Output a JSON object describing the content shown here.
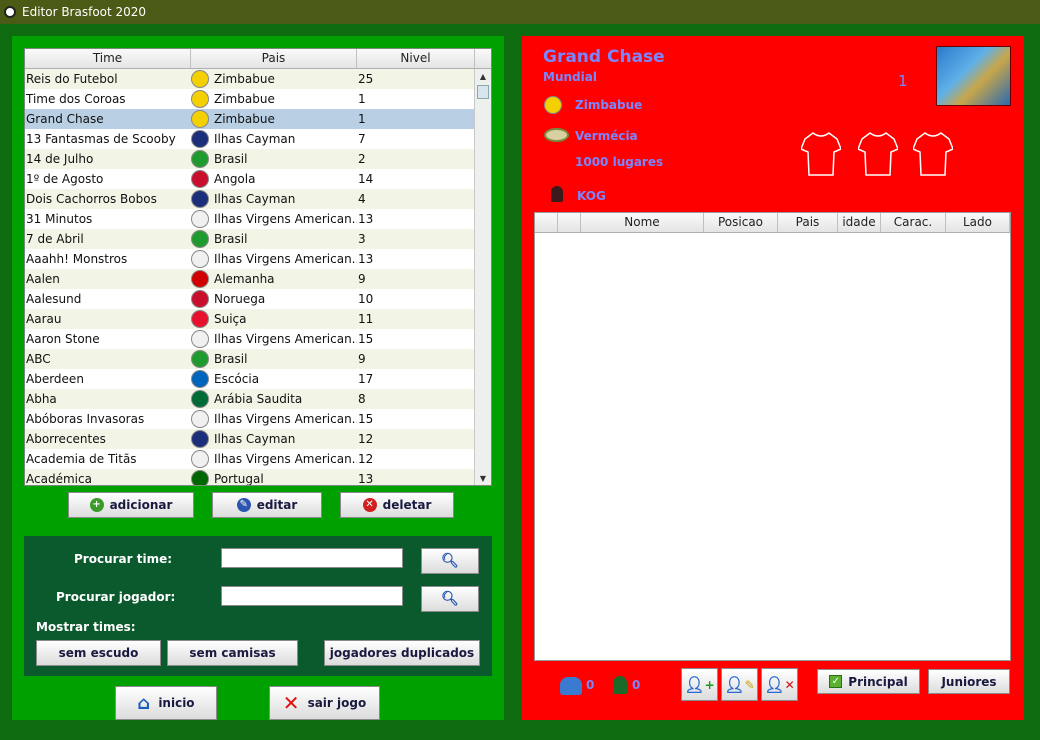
{
  "window": {
    "title": "Editor Brasfoot 2020"
  },
  "teams_table": {
    "headers": {
      "time": "Time",
      "pais": "Pais",
      "nivel": "Nivel"
    },
    "rows": [
      {
        "time": "Reis do Futebol",
        "pais": "Zimbabue",
        "nivel": "25",
        "flag": "zimbabwe-flag-icon",
        "color": "#f4d000"
      },
      {
        "time": "Time dos Coroas",
        "pais": "Zimbabue",
        "nivel": "1",
        "flag": "zimbabwe-flag-icon",
        "color": "#f4d000"
      },
      {
        "time": "Grand Chase",
        "pais": "Zimbabue",
        "nivel": "1",
        "flag": "zimbabwe-flag-icon",
        "color": "#f4d000"
      },
      {
        "time": "13 Fantasmas de Scooby",
        "pais": "Ilhas Cayman",
        "nivel": "7",
        "flag": "cayman-flag-icon",
        "color": "#1c2f7a"
      },
      {
        "time": "14 de Julho",
        "pais": "Brasil",
        "nivel": "2",
        "flag": "brazil-flag-icon",
        "color": "#1f9a2c"
      },
      {
        "time": "1º de Agosto",
        "pais": "Angola",
        "nivel": "14",
        "flag": "angola-flag-icon",
        "color": "#c8102e"
      },
      {
        "time": "Dois Cachorros Bobos",
        "pais": "Ilhas Cayman",
        "nivel": "4",
        "flag": "cayman-flag-icon",
        "color": "#1c2f7a"
      },
      {
        "time": "31 Minutos",
        "pais": "Ilhas Virgens American...",
        "nivel": "13",
        "flag": "usvi-flag-icon",
        "color": "#f0f0f0"
      },
      {
        "time": "7 de Abril",
        "pais": "Brasil",
        "nivel": "3",
        "flag": "brazil-flag-icon",
        "color": "#1f9a2c"
      },
      {
        "time": "Aaahh! Monstros",
        "pais": "Ilhas Virgens American...",
        "nivel": "13",
        "flag": "usvi-flag-icon",
        "color": "#f0f0f0"
      },
      {
        "time": "Aalen",
        "pais": "Alemanha",
        "nivel": "9",
        "flag": "germany-flag-icon",
        "color": "#d00000"
      },
      {
        "time": "Aalesund",
        "pais": "Noruega",
        "nivel": "10",
        "flag": "norway-flag-icon",
        "color": "#c8102e"
      },
      {
        "time": "Aarau",
        "pais": "Suiça",
        "nivel": "11",
        "flag": "switzerland-flag-icon",
        "color": "#e8112d"
      },
      {
        "time": "Aaron Stone",
        "pais": "Ilhas Virgens American...",
        "nivel": "15",
        "flag": "usvi-flag-icon",
        "color": "#f0f0f0"
      },
      {
        "time": "ABC",
        "pais": "Brasil",
        "nivel": "9",
        "flag": "brazil-flag-icon",
        "color": "#1f9a2c"
      },
      {
        "time": "Aberdeen",
        "pais": "Escócia",
        "nivel": "17",
        "flag": "scotland-flag-icon",
        "color": "#0065bd"
      },
      {
        "time": "Abha",
        "pais": "Arábia Saudita",
        "nivel": "8",
        "flag": "saudi-flag-icon",
        "color": "#006c35"
      },
      {
        "time": "Abóboras Invasoras",
        "pais": "Ilhas Virgens American...",
        "nivel": "15",
        "flag": "usvi-flag-icon",
        "color": "#f0f0f0"
      },
      {
        "time": "Aborrecentes",
        "pais": "Ilhas Cayman",
        "nivel": "12",
        "flag": "cayman-flag-icon",
        "color": "#1c2f7a"
      },
      {
        "time": "Academia de Titãs",
        "pais": "Ilhas Virgens American...",
        "nivel": "12",
        "flag": "usvi-flag-icon",
        "color": "#f0f0f0"
      },
      {
        "time": "Académica",
        "pais": "Portugal",
        "nivel": "13",
        "flag": "portugal-flag-icon",
        "color": "#006600"
      }
    ],
    "selected_index": 2
  },
  "actions": {
    "add": "adicionar",
    "edit": "editar",
    "delete": "deletar"
  },
  "search": {
    "team_label": "Procurar time:",
    "player_label": "Procurar jogador:",
    "show_label": "Mostrar times:",
    "no_crest": "sem escudo",
    "no_shirts": "sem camisas",
    "duplicates": "jogadores duplicados"
  },
  "nav": {
    "home": "inicio",
    "exit": "sair jogo"
  },
  "team_detail": {
    "name": "Grand Chase",
    "competition": "Mundial",
    "rank": "1",
    "country": "Zimbabue",
    "stadium": "Vermécia",
    "capacity": "1000 lugares",
    "coach": "KOG"
  },
  "players_table": {
    "headers": [
      "",
      "",
      "Nome",
      "Posicao",
      "Pais",
      "idade",
      "Carac.",
      "Lado"
    ]
  },
  "footer": {
    "players_count": "0",
    "juniors_count": "0",
    "main": "Principal",
    "juniors": "Juniores"
  }
}
